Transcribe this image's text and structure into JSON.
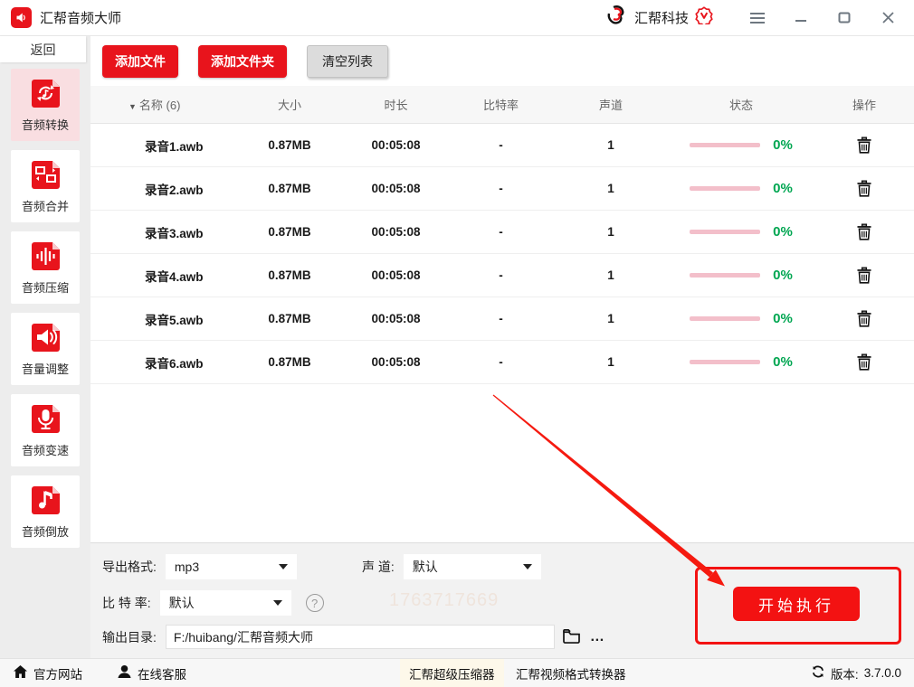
{
  "colors": {
    "accent_red": "#e8141c",
    "start_red": "#f31212",
    "progress_pink": "#f3bfca",
    "percent_green": "#00a651",
    "annotation_red": "#f51a10",
    "active_nav_pink": "#f9dee1"
  },
  "title_bar": {
    "app_title": "汇帮音频大师",
    "brand_name": "汇帮科技"
  },
  "sidebar": {
    "back_label": "返回",
    "items": [
      {
        "label": "音频转换",
        "icon": "audio-convert-icon",
        "active": true
      },
      {
        "label": "音频合并",
        "icon": "audio-merge-icon",
        "active": false
      },
      {
        "label": "音频压缩",
        "icon": "audio-compress-icon",
        "active": false
      },
      {
        "label": "音量调整",
        "icon": "volume-adjust-icon",
        "active": false
      },
      {
        "label": "音频变速",
        "icon": "audio-speed-icon",
        "active": false
      },
      {
        "label": "音频倒放",
        "icon": "audio-reverse-icon",
        "active": false
      }
    ]
  },
  "toolbar": {
    "add_file_label": "添加文件",
    "add_folder_label": "添加文件夹",
    "clear_list_label": "清空列表"
  },
  "table": {
    "sort_caret": "▼",
    "headers": {
      "name": "名称 (6)",
      "size": "大小",
      "duration": "时长",
      "bitrate": "比特率",
      "channels": "声道",
      "status": "状态",
      "action": "操作"
    },
    "rows": [
      {
        "name": "录音1.awb",
        "size": "0.87MB",
        "duration": "00:05:08",
        "bitrate": "-",
        "channels": "1",
        "percent": "0%"
      },
      {
        "name": "录音2.awb",
        "size": "0.87MB",
        "duration": "00:05:08",
        "bitrate": "-",
        "channels": "1",
        "percent": "0%"
      },
      {
        "name": "录音3.awb",
        "size": "0.87MB",
        "duration": "00:05:08",
        "bitrate": "-",
        "channels": "1",
        "percent": "0%"
      },
      {
        "name": "录音4.awb",
        "size": "0.87MB",
        "duration": "00:05:08",
        "bitrate": "-",
        "channels": "1",
        "percent": "0%"
      },
      {
        "name": "录音5.awb",
        "size": "0.87MB",
        "duration": "00:05:08",
        "bitrate": "-",
        "channels": "1",
        "percent": "0%"
      },
      {
        "name": "录音6.awb",
        "size": "0.87MB",
        "duration": "00:05:08",
        "bitrate": "-",
        "channels": "1",
        "percent": "0%"
      }
    ]
  },
  "settings": {
    "export_format_label": "导出格式:",
    "export_format_value": "mp3",
    "channel_label": "声 道:",
    "channel_value": "默认",
    "bitrate_label": "比 特 率:",
    "bitrate_value": "默认",
    "help_glyph": "?",
    "watermark": "1763717669",
    "output_dir_label": "输出目录:",
    "output_dir_value": "F:/huibang/汇帮音频大师",
    "ellipsis_label": "…",
    "start_button_label": "开始执行"
  },
  "status_bar": {
    "official_site_label": "官方网站",
    "online_service_label": "在线客服",
    "link_compressor_label": "汇帮超级压缩器",
    "link_video_converter_label": "汇帮视频格式转换器",
    "version_label": "版本:",
    "version_value": "3.7.0.0"
  }
}
